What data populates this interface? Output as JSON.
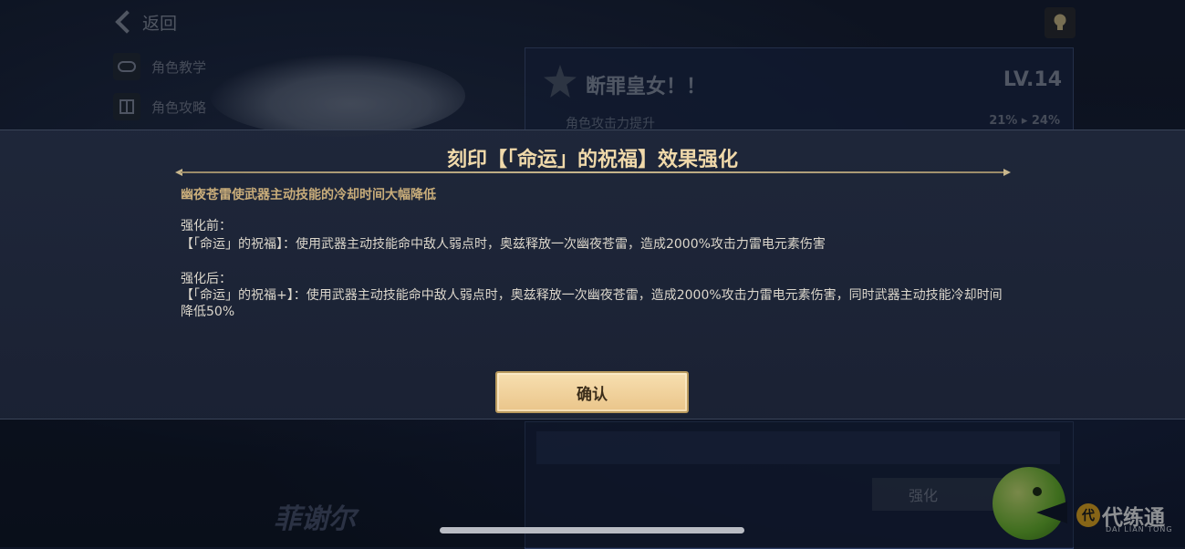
{
  "background": {
    "back_label": "返回",
    "side_items": [
      {
        "label": "角色教学",
        "icon": "gamepad-icon"
      },
      {
        "label": "角色攻略",
        "icon": "book-icon"
      }
    ],
    "card": {
      "title": "断罪皇女！！",
      "level": "LV.14",
      "stat_label": "角色攻击力提升",
      "stat_value": "21% ▸ 24%"
    },
    "enhance_label": "强化",
    "character_name": "菲谢尔",
    "logo": {
      "name": "代练通",
      "subtitle": "DAI LIAN TONG"
    }
  },
  "dialog": {
    "title": "刻印【「命运」的祝福】效果强化",
    "summary": "幽夜苍雷使武器主动技能的冷却时间大幅降低",
    "before_label": "强化前：",
    "before_text": "【「命运」的祝福】：使用武器主动技能命中敌人弱点时，奥兹释放一次幽夜苍雷，造成2000%攻击力雷电元素伤害",
    "after_label": "强化后：",
    "after_text": "【「命运」的祝福+】：使用武器主动技能命中敌人弱点时，奥兹释放一次幽夜苍雷，造成2000%攻击力雷电元素伤害，同时武器主动技能冷却时间降低50%",
    "confirm_label": "确认"
  },
  "colors": {
    "accent_gold": "#f0d9aa",
    "button_fill": "#eac58a",
    "panel_bg": "#1f273a"
  }
}
